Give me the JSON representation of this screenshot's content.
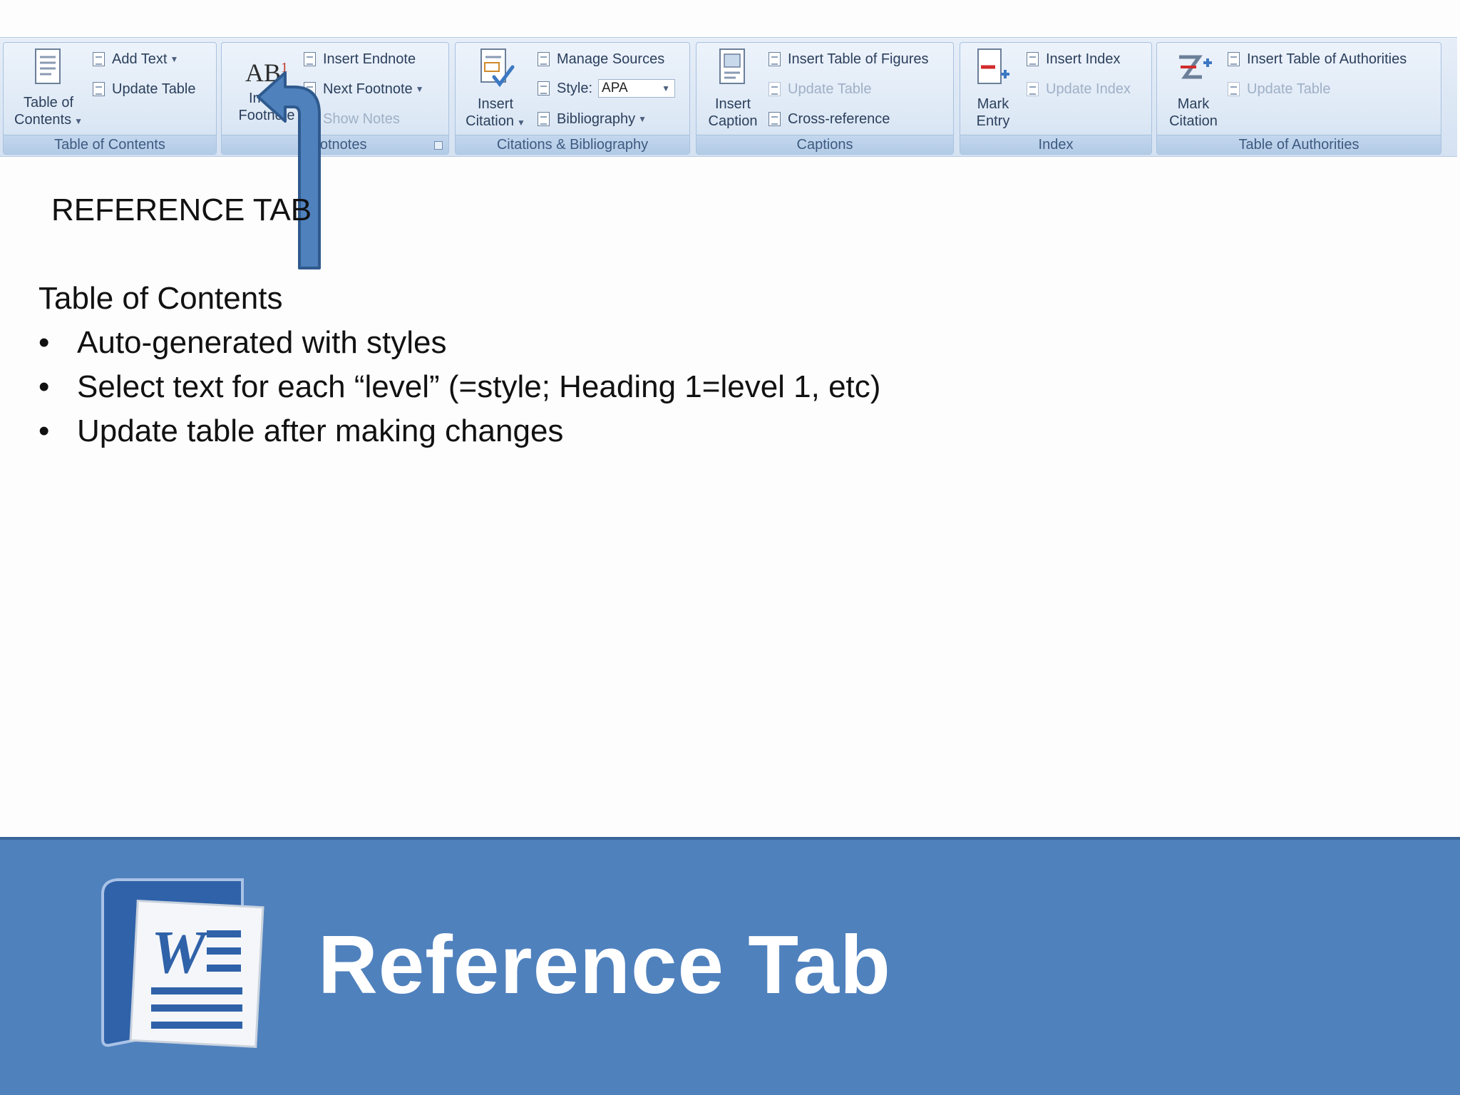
{
  "ribbon": {
    "toc_group": {
      "label": "Table of Contents",
      "toc_button_line1": "Table of",
      "toc_button_line2": "Contents",
      "add_text": "Add Text",
      "update_table": "Update Table"
    },
    "footnotes_group": {
      "label": "Footnotes",
      "insert_footnote_line1": "Insert",
      "insert_footnote_line2": "Footnote",
      "insert_endnote": "Insert Endnote",
      "next_footnote": "Next Footnote",
      "show_notes": "Show Notes",
      "icon_text": "AB",
      "icon_superscript": "1"
    },
    "citations_group": {
      "label": "Citations & Bibliography",
      "insert_citation_line1": "Insert",
      "insert_citation_line2": "Citation",
      "manage_sources": "Manage Sources",
      "style_label": "Style:",
      "style_value": "APA",
      "bibliography": "Bibliography"
    },
    "captions_group": {
      "label": "Captions",
      "insert_caption_line1": "Insert",
      "insert_caption_line2": "Caption",
      "insert_table_of_figures": "Insert Table of Figures",
      "update_table": "Update Table",
      "cross_reference": "Cross-reference"
    },
    "index_group": {
      "label": "Index",
      "mark_entry_line1": "Mark",
      "mark_entry_line2": "Entry",
      "insert_index": "Insert Index",
      "update_index": "Update Index"
    },
    "authorities_group": {
      "label": "Table of Authorities",
      "mark_citation_line1": "Mark",
      "mark_citation_line2": "Citation",
      "insert_table_of_authorities": "Insert Table of Authorities",
      "update_table": "Update Table"
    }
  },
  "slide": {
    "reference_label": "REFERENCE TAB",
    "heading": "Table of Contents",
    "bullets": [
      "Auto-generated with styles",
      "Select text for each “level” (=style; Heading 1=level 1, etc)",
      "Update table after making changes"
    ],
    "banner_title": "Reference Tab",
    "logo_letter": "W"
  },
  "colors": {
    "banner": "#4f81bd",
    "arrow": "#4f81bd",
    "arrow_outline": "#2f5a8e"
  },
  "icons": [
    "document-icon",
    "footnote-icon",
    "citation-icon",
    "caption-icon",
    "mark-entry-icon",
    "mark-citation-icon",
    "word-logo-icon",
    "up-arrow-icon"
  ]
}
